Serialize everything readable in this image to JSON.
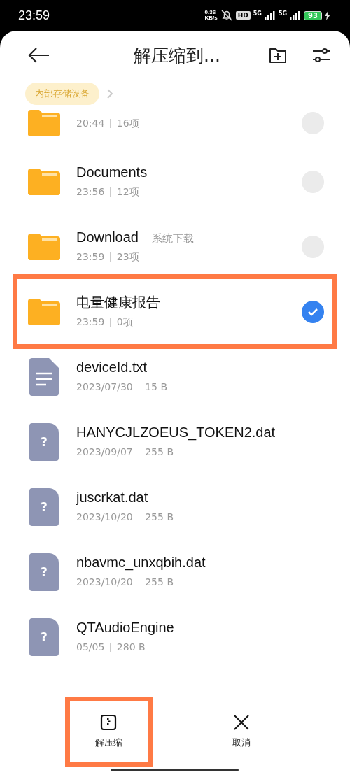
{
  "status_bar": {
    "time": "23:59",
    "speed_value": "0.36",
    "speed_unit": "KB/s",
    "hd_label": "HD",
    "networks": [
      "5G",
      "5G"
    ],
    "battery": "93"
  },
  "header": {
    "title": "解压缩到..."
  },
  "breadcrumb": {
    "label": "内部存储设备"
  },
  "items": [
    {
      "kind": "folder",
      "date": "20:44",
      "info": "16项",
      "selected": false,
      "highlighted": false,
      "clipped": true
    },
    {
      "kind": "folder",
      "name": "Documents",
      "date": "23:56",
      "info": "12项",
      "selected": false,
      "highlighted": false
    },
    {
      "kind": "folder",
      "name": "Download",
      "tag": "系统下载",
      "date": "23:59",
      "info": "23项",
      "selected": false,
      "highlighted": false
    },
    {
      "kind": "folder",
      "name": "电量健康报告",
      "date": "23:59",
      "info": "0项",
      "selected": true,
      "highlighted": true
    },
    {
      "kind": "text_file",
      "name": "deviceId.txt",
      "date": "2023/07/30",
      "info": "15 B",
      "highlighted": false
    },
    {
      "kind": "unknown_file",
      "glyph": "?",
      "name": "HANYCJLZOEUS_TOKEN2.dat",
      "date": "2023/09/07",
      "info": "255 B",
      "highlighted": false
    },
    {
      "kind": "unknown_file",
      "glyph": "?",
      "name": "juscrkat.dat",
      "date": "2023/10/20",
      "info": "255 B",
      "highlighted": false
    },
    {
      "kind": "unknown_file",
      "glyph": "?",
      "name": "nbavmc_unxqbih.dat",
      "date": "2023/10/20",
      "info": "255 B",
      "highlighted": false
    },
    {
      "kind": "unknown_file",
      "glyph": "?",
      "name": "QTAudioEngine",
      "date": "05/05",
      "info": "280 B",
      "highlighted": false
    }
  ],
  "actions": [
    {
      "kind": "extract",
      "label": "解压缩",
      "highlighted": true
    },
    {
      "kind": "cancel",
      "label": "取消",
      "highlighted": false
    }
  ]
}
